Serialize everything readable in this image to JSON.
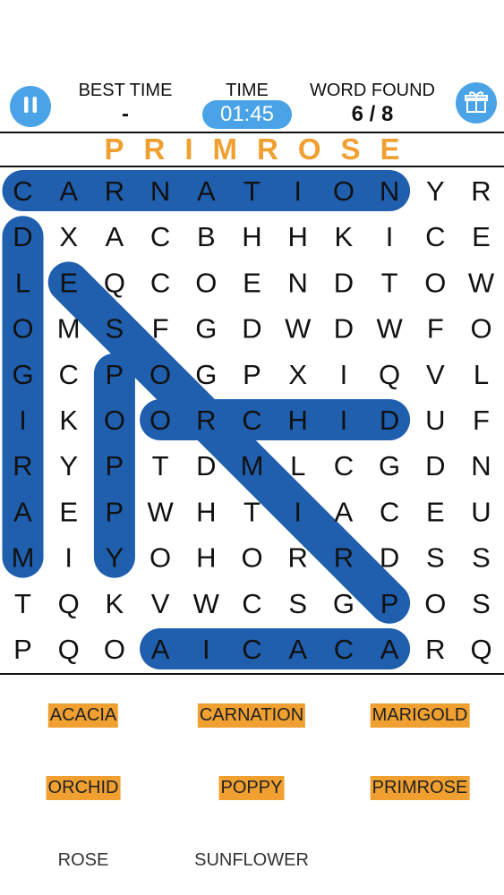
{
  "header": {
    "best_time_label": "BEST TIME",
    "best_time_value": "-",
    "time_label": "TIME",
    "time_value": "01:45",
    "word_found_label": "WORD FOUND",
    "word_found_value": "6 / 8"
  },
  "current_word": "PRIMROSE",
  "colors": {
    "accent_blue": "#4aa3e6",
    "highlight_blue": "#1f5fae",
    "found_orange": "#f0a030"
  },
  "icons": {
    "pause": "pause-icon",
    "gift": "gift-icon"
  },
  "grid": [
    [
      "C",
      "A",
      "R",
      "N",
      "A",
      "T",
      "I",
      "O",
      "N",
      "Y",
      "R"
    ],
    [
      "D",
      "X",
      "A",
      "C",
      "B",
      "H",
      "H",
      "K",
      "I",
      "C",
      "E"
    ],
    [
      "L",
      "E",
      "Q",
      "C",
      "O",
      "E",
      "N",
      "D",
      "T",
      "O",
      "W"
    ],
    [
      "O",
      "M",
      "S",
      "F",
      "G",
      "D",
      "W",
      "D",
      "W",
      "F",
      "O"
    ],
    [
      "G",
      "C",
      "P",
      "O",
      "G",
      "P",
      "X",
      "I",
      "Q",
      "V",
      "L"
    ],
    [
      "I",
      "K",
      "O",
      "O",
      "R",
      "C",
      "H",
      "I",
      "D",
      "U",
      "F"
    ],
    [
      "R",
      "Y",
      "P",
      "T",
      "D",
      "M",
      "L",
      "C",
      "G",
      "D",
      "N"
    ],
    [
      "A",
      "E",
      "P",
      "W",
      "H",
      "T",
      "I",
      "A",
      "C",
      "E",
      "U"
    ],
    [
      "M",
      "I",
      "Y",
      "O",
      "H",
      "O",
      "R",
      "R",
      "D",
      "S",
      "S"
    ],
    [
      "T",
      "Q",
      "K",
      "V",
      "W",
      "C",
      "S",
      "G",
      "P",
      "O",
      "S"
    ],
    [
      "P",
      "Q",
      "O",
      "A",
      "I",
      "C",
      "A",
      "C",
      "A",
      "R",
      "Q"
    ]
  ],
  "found_highlights": [
    {
      "word": "CARNATION",
      "from": [
        0,
        0
      ],
      "to": [
        0,
        8
      ]
    },
    {
      "word": "MARIGOLD",
      "from": [
        1,
        0
      ],
      "to": [
        8,
        0
      ]
    },
    {
      "word": "PRIMROSE",
      "from": [
        2,
        1
      ],
      "to": [
        9,
        8
      ]
    },
    {
      "word": "POPPY",
      "from": [
        4,
        2
      ],
      "to": [
        8,
        2
      ]
    },
    {
      "word": "ORCHID",
      "from": [
        5,
        3
      ],
      "to": [
        5,
        8
      ]
    },
    {
      "word": "ACACIA",
      "from": [
        10,
        3
      ],
      "to": [
        10,
        8
      ]
    }
  ],
  "word_list": [
    {
      "label": "ACACIA",
      "found": true
    },
    {
      "label": "CARNATION",
      "found": true
    },
    {
      "label": "MARIGOLD",
      "found": true
    },
    {
      "label": "ORCHID",
      "found": true
    },
    {
      "label": "POPPY",
      "found": true
    },
    {
      "label": "PRIMROSE",
      "found": true
    },
    {
      "label": "ROSE",
      "found": false
    },
    {
      "label": "SUNFLOWER",
      "found": false
    }
  ]
}
